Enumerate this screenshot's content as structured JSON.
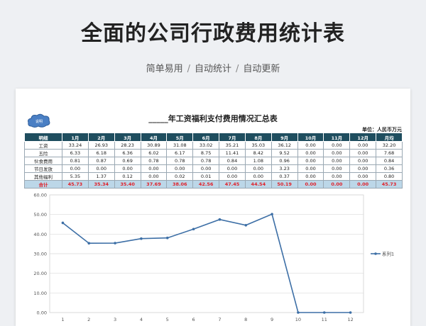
{
  "header": {
    "title": "全面的公司行政费用统计表",
    "tagline": [
      "简单易用",
      "自动统计",
      "自动更新"
    ]
  },
  "sheet": {
    "badge_label": "说明",
    "title": "_____年工资福利支付费用情况汇总表",
    "unit": "单位：人民币万元",
    "columns": [
      "明细",
      "1月",
      "2月",
      "3月",
      "4月",
      "5月",
      "6月",
      "7月",
      "8月",
      "9月",
      "10月",
      "11月",
      "12月",
      "月均"
    ],
    "rows": [
      [
        "工资",
        "33.24",
        "26.93",
        "28.23",
        "30.89",
        "31.08",
        "33.02",
        "35.21",
        "35.03",
        "36.12",
        "0.00",
        "0.00",
        "0.00",
        "32.20"
      ],
      [
        "五险",
        "6.33",
        "6.18",
        "6.36",
        "6.02",
        "6.17",
        "8.75",
        "11.41",
        "8.42",
        "9.52",
        "0.00",
        "0.00",
        "0.00",
        "7.68"
      ],
      [
        "伙食费用",
        "0.81",
        "0.87",
        "0.69",
        "0.78",
        "0.78",
        "0.78",
        "0.84",
        "1.08",
        "0.96",
        "0.00",
        "0.00",
        "0.00",
        "0.84"
      ],
      [
        "节日发放",
        "0.00",
        "0.00",
        "0.00",
        "0.00",
        "0.00",
        "0.00",
        "0.00",
        "0.00",
        "3.23",
        "0.00",
        "0.00",
        "0.00",
        "0.36"
      ],
      [
        "其他福利",
        "5.35",
        "1.37",
        "0.12",
        "0.00",
        "0.02",
        "0.01",
        "0.00",
        "0.00",
        "0.37",
        "0.00",
        "0.00",
        "0.00",
        "0.80"
      ]
    ],
    "total_row": [
      "合计",
      "45.73",
      "35.34",
      "35.40",
      "37.69",
      "38.06",
      "42.56",
      "47.45",
      "44.54",
      "50.19",
      "0.00",
      "0.00",
      "0.00",
      "45.73"
    ]
  },
  "chart_data": {
    "type": "line",
    "x": [
      1,
      2,
      3,
      4,
      5,
      6,
      7,
      8,
      9,
      10,
      11,
      12
    ],
    "series": [
      {
        "name": "系列1",
        "values": [
          45.73,
          35.34,
          35.4,
          37.69,
          38.06,
          42.56,
          47.45,
          44.54,
          50.19,
          0.0,
          0.0,
          0.0
        ]
      }
    ],
    "ylim": [
      0,
      60
    ],
    "yticks": [
      "0.00",
      "10.00",
      "20.00",
      "30.00",
      "40.00",
      "50.00",
      "60.00"
    ],
    "xticks": [
      "1",
      "2",
      "3",
      "4",
      "5",
      "6",
      "7",
      "8",
      "9",
      "10",
      "11",
      "12"
    ],
    "grid": true,
    "legend": "right",
    "color": "#3d6fa6"
  }
}
